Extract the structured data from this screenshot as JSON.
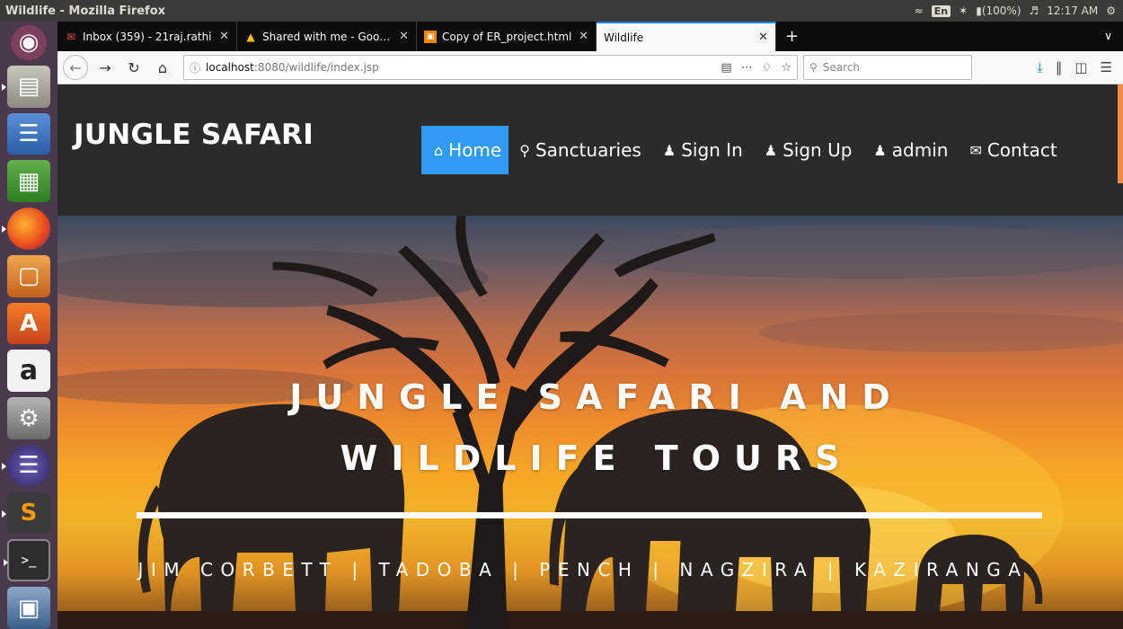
{
  "os": {
    "window_title": "Wildlife - Mozilla Firefox",
    "lang": "En",
    "battery": "(100%)",
    "clock": "12:17 AM"
  },
  "launcher": {
    "icons": [
      "ubuntu-icon",
      "files-icon",
      "writer-icon",
      "calc-icon",
      "firefox-icon",
      "impress-icon",
      "software-center-icon",
      "amazon-icon",
      "settings-icon",
      "eclipse-icon",
      "sublime-icon",
      "terminal-icon",
      "screens-icon"
    ]
  },
  "browser": {
    "tabs": [
      {
        "label": "Inbox (359) - 21raj.rathi",
        "favicon": "gmail-icon"
      },
      {
        "label": "Shared with me - Google",
        "favicon": "drive-icon"
      },
      {
        "label": "Copy of ER_project.html",
        "favicon": "drawio-icon"
      },
      {
        "label": "Wildlife",
        "favicon": "",
        "selected": true
      }
    ],
    "url_host": "localhost",
    "url_path": ":8080/wildlife/index.jsp",
    "search_placeholder": "Search",
    "accent": "#0a84ff"
  },
  "site": {
    "brand": "JUNGLE SAFARI",
    "nav": [
      {
        "label": "Home",
        "icon": "home-icon",
        "active": true
      },
      {
        "label": "Sanctuaries",
        "icon": "search-icon"
      },
      {
        "label": "Sign In",
        "icon": "user-icon"
      },
      {
        "label": "Sign Up",
        "icon": "user-icon"
      },
      {
        "label": "admin",
        "icon": "user-icon"
      },
      {
        "label": "Contact",
        "icon": "envelope-icon"
      }
    ],
    "nav_active_color": "#2f9bf5",
    "hero": {
      "title": "JUNGLE SAFARI AND WILDLIFE TOURS",
      "subtitle": "JIM CORBETT | TADOBA | PENCH | NAGZIRA | KAZIRANGA"
    }
  }
}
